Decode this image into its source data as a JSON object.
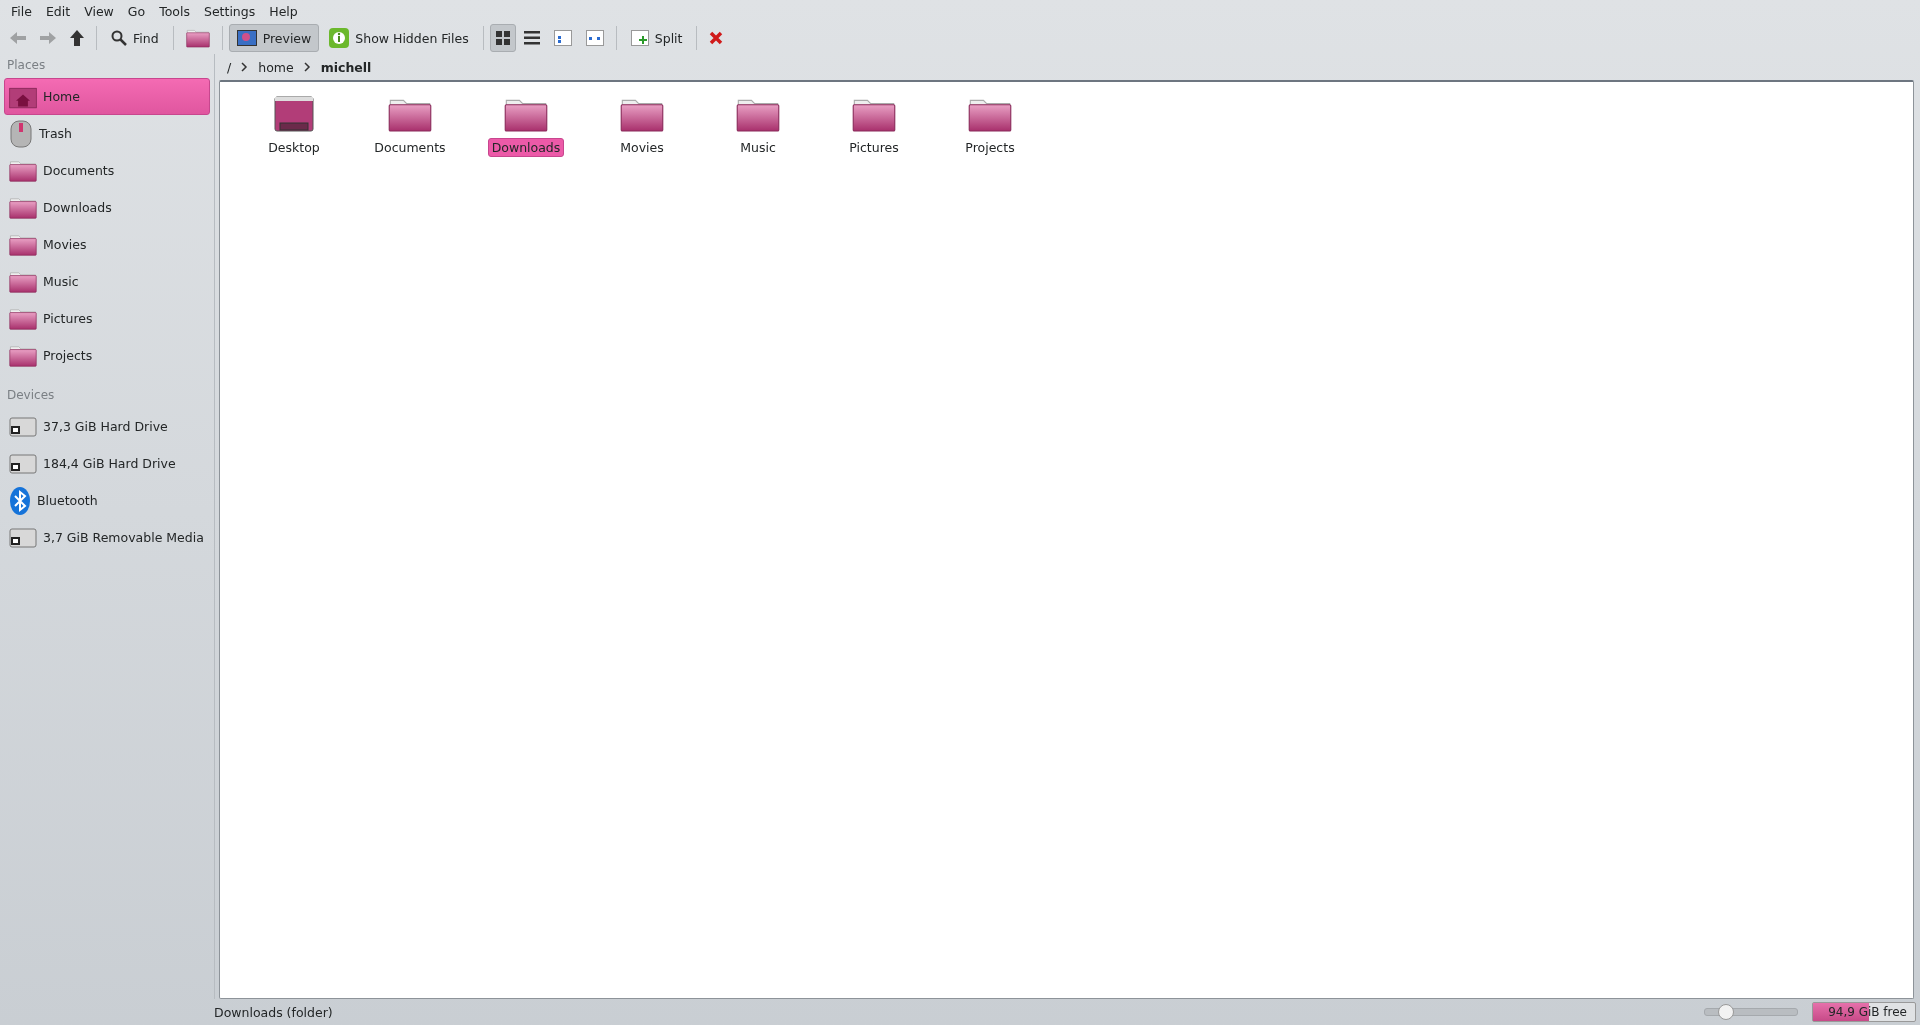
{
  "menu": [
    "File",
    "Edit",
    "View",
    "Go",
    "Tools",
    "Settings",
    "Help"
  ],
  "toolbar": [
    {
      "kind": "back",
      "pressed": false,
      "disabled": true
    },
    {
      "kind": "forward",
      "pressed": false,
      "disabled": true
    },
    {
      "kind": "up",
      "pressed": false,
      "disabled": false
    },
    {
      "kind": "separator"
    },
    {
      "kind": "search",
      "label": "Find",
      "pressed": false,
      "disabled": false
    },
    {
      "kind": "separator"
    },
    {
      "kind": "folder",
      "pressed": false,
      "disabled": false
    },
    {
      "kind": "separator"
    },
    {
      "kind": "preview",
      "label": "Preview",
      "pressed": true,
      "disabled": false
    },
    {
      "kind": "info",
      "label": "Show Hidden Files",
      "pressed": false,
      "disabled": false
    },
    {
      "kind": "separator"
    },
    {
      "kind": "grid",
      "pressed": true,
      "disabled": false
    },
    {
      "kind": "list",
      "pressed": false,
      "disabled": false
    },
    {
      "kind": "compact",
      "pressed": false,
      "disabled": false
    },
    {
      "kind": "columns",
      "pressed": false,
      "disabled": false
    },
    {
      "kind": "separator"
    },
    {
      "kind": "split",
      "label": "Split",
      "pressed": false,
      "disabled": false
    },
    {
      "kind": "separator"
    },
    {
      "kind": "close",
      "pressed": false,
      "disabled": false
    }
  ],
  "sidebar": {
    "sections": [
      {
        "title": "Places",
        "items": [
          {
            "label": "Home",
            "kind": "home",
            "selected": true
          },
          {
            "label": "Trash",
            "kind": "trash",
            "selected": false
          },
          {
            "label": "Documents",
            "kind": "folder",
            "selected": false
          },
          {
            "label": "Downloads",
            "kind": "folder",
            "selected": false
          },
          {
            "label": "Movies",
            "kind": "folder",
            "selected": false
          },
          {
            "label": "Music",
            "kind": "folder",
            "selected": false
          },
          {
            "label": "Pictures",
            "kind": "folder",
            "selected": false
          },
          {
            "label": "Projects",
            "kind": "folder",
            "selected": false
          }
        ]
      },
      {
        "title": "Devices",
        "items": [
          {
            "label": "37,3 GiB Hard Drive",
            "kind": "drive",
            "selected": false
          },
          {
            "label": "184,4 GiB Hard Drive",
            "kind": "drive",
            "selected": false
          },
          {
            "label": "Bluetooth",
            "kind": "bluetooth",
            "selected": false
          },
          {
            "label": "3,7 GiB Removable Media",
            "kind": "drive",
            "selected": false
          }
        ]
      }
    ]
  },
  "breadcrumb": [
    {
      "label": "/",
      "current": false
    },
    {
      "label": "home",
      "current": false
    },
    {
      "label": "michell",
      "current": true
    }
  ],
  "files": [
    {
      "name": "Desktop",
      "kind": "desktop",
      "selected": false
    },
    {
      "name": "Documents",
      "kind": "folder",
      "selected": false
    },
    {
      "name": "Downloads",
      "kind": "folder",
      "selected": true
    },
    {
      "name": "Movies",
      "kind": "folder",
      "selected": false
    },
    {
      "name": "Music",
      "kind": "folder",
      "selected": false
    },
    {
      "name": "Pictures",
      "kind": "folder",
      "selected": false
    },
    {
      "name": "Projects",
      "kind": "folder",
      "selected": false
    }
  ],
  "status_bar": {
    "text": "Downloads (folder)",
    "zoom": {
      "level": 0.22
    },
    "free_space": {
      "label": "94,9 GiB free",
      "level": 0.55
    }
  }
}
